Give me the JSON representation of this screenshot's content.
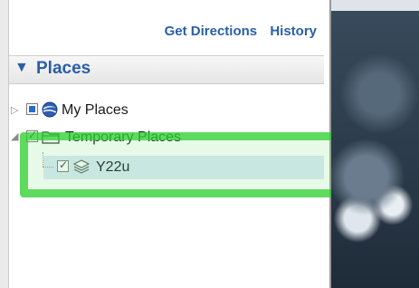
{
  "toolbar": {
    "get_directions": "Get Directions",
    "history": "History"
  },
  "places_panel": {
    "title": "Places",
    "expand_glyph": "▼"
  },
  "tree": {
    "items": [
      {
        "label": "My Places",
        "checkbox": "partial",
        "icon": "globe-icon",
        "expander": "▷"
      },
      {
        "label": "Temporary Places",
        "checkbox": "checked",
        "icon": "folder-icon",
        "expander": "◢"
      },
      {
        "label": "Y22u",
        "checkbox": "checked",
        "icon": "layers-icon",
        "selected": true
      }
    ]
  },
  "colors": {
    "accent": "#2a5fa8",
    "highlight": "#28cd28",
    "selection": "#dbe8f8"
  }
}
